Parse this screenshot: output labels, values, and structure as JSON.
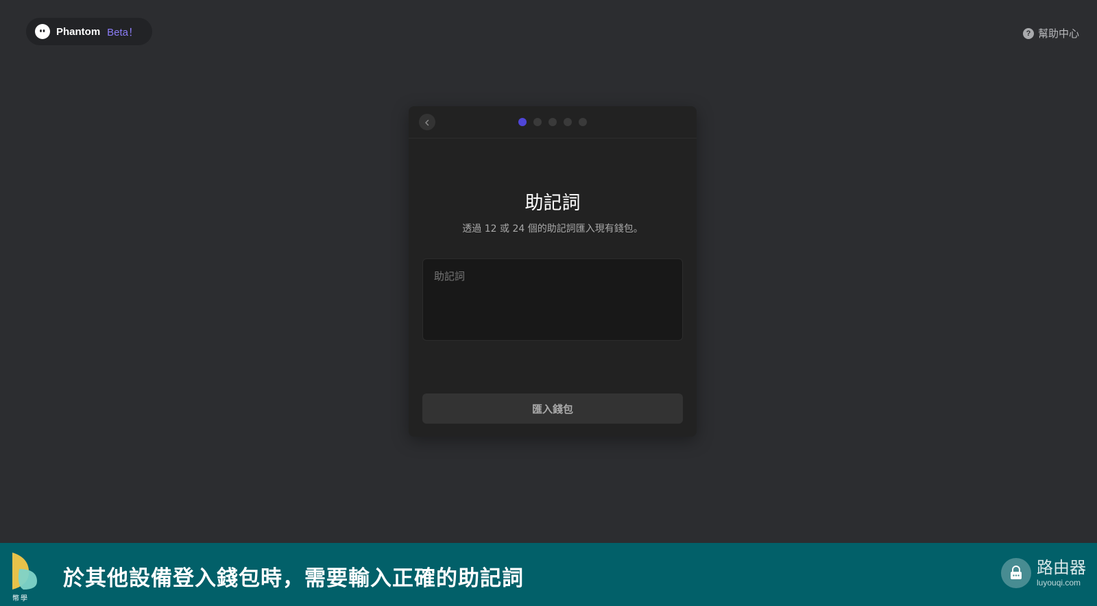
{
  "header": {
    "app_name": "Phantom",
    "beta_label": "Beta！",
    "help_label": "幫助中心",
    "help_icon": "question-circle-icon",
    "logo_icon": "phantom-ghost-icon"
  },
  "card": {
    "back_icon": "chevron-left-icon",
    "steps_total": 5,
    "step_current": 1,
    "title": "助記詞",
    "subtitle": "透過 12 或 24 個的助記詞匯入現有錢包。",
    "mnemonic_placeholder": "助記詞",
    "mnemonic_value": "",
    "import_button": "匯入錢包"
  },
  "banner": {
    "caption": "於其他設備登入錢包時，需要輸入正確的助記詞",
    "logo_text": "幣學",
    "watermark_cn": "路由器",
    "watermark_en": "luyouqi.com"
  },
  "colors": {
    "background": "#2c2d30",
    "card": "#222222",
    "accent": "#4f46d8",
    "beta": "#8b7cf6",
    "banner": "#026069"
  }
}
